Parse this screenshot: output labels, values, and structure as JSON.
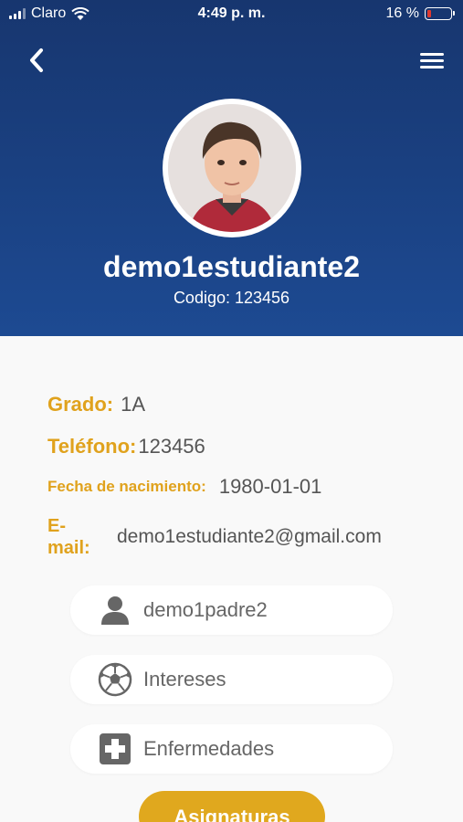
{
  "status_bar": {
    "carrier": "Claro",
    "time": "4:49 p. m.",
    "battery_text": "16 %",
    "battery_level": 0.16
  },
  "profile": {
    "username": "demo1estudiante2",
    "codigo": "Codigo: 123456"
  },
  "details": {
    "grado_label": "Grado:",
    "grado_value": "1A",
    "telefono_label": "Teléfono:",
    "telefono_value": "123456",
    "fecha_label": "Fecha de nacimiento:",
    "fecha_value": "1980-01-01",
    "email_label_1": "E-",
    "email_label_2": "mail:",
    "email_value": "demo1estudiante2@gmail.com"
  },
  "actions": {
    "parent": "demo1padre2",
    "interests": "Intereses",
    "diseases": "Enfermedades",
    "subjects": "Asignaturas"
  },
  "colors": {
    "header": "#1d4a92",
    "accent": "#e0a21d",
    "battery_low": "#e0392f"
  },
  "icons": [
    "back-icon",
    "menu-icon",
    "wifi-icon",
    "person-icon",
    "soccer-ball-icon",
    "medical-cross-icon"
  ]
}
